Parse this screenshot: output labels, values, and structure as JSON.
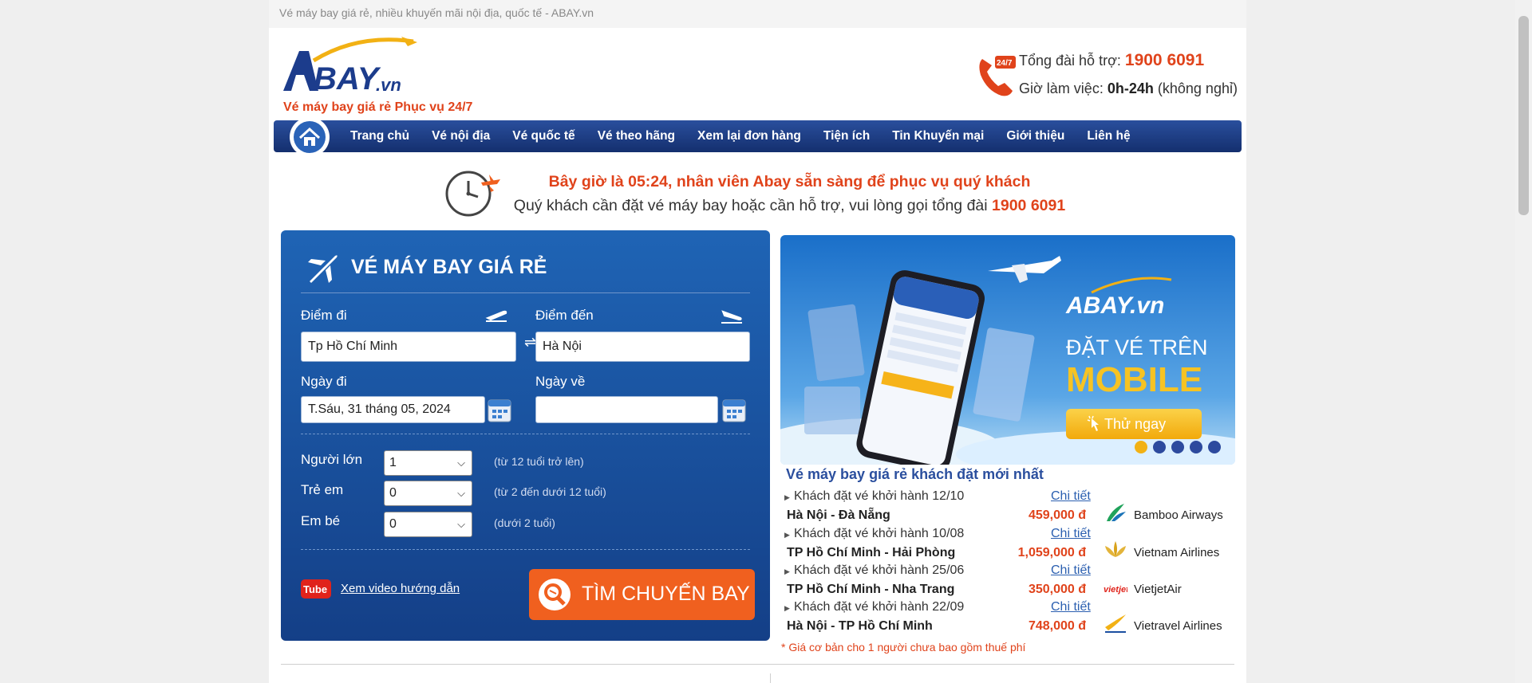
{
  "topbar": {
    "title": "Vé máy bay giá rẻ, nhiều khuyến mãi nội địa, quốc tế - ABAY.vn"
  },
  "header": {
    "logo_text": "ABAY.vn",
    "slogan": "Vé máy bay giá rẻ Phục vụ 24/7",
    "hotline_badge": "24/7",
    "hotline_label": "Tổng đài hỗ trợ:",
    "hotline_number": "1900 6091",
    "hours_label": "Giờ làm việc:",
    "hours_value": "0h-24h",
    "hours_note": "(không nghỉ)"
  },
  "nav": {
    "items": [
      "Trang chủ",
      "Vé nội địa",
      "Vé quốc tế",
      "Vé theo hãng",
      "Xem lại đơn hàng",
      "Tiện ích",
      "Tin Khuyến mại",
      "Giới thiệu",
      "Liên hệ"
    ]
  },
  "notice": {
    "line1": "Bây giờ là 05:24, nhân viên Abay sẵn sàng để phục vụ quý khách",
    "line2": "Quý khách cần đặt vé máy bay hoặc cần hỗ trợ, vui lòng gọi tổng đài",
    "line2_number": "1900 6091"
  },
  "search": {
    "title": "VÉ MÁY BAY GIÁ RẺ",
    "from_label": "Điểm đi",
    "from_value": "Tp Hồ Chí Minh",
    "to_label": "Điểm đến",
    "to_value": "Hà Nội",
    "swap_glyph": "⇌",
    "depart_label": "Ngày đi",
    "depart_value": "T.Sáu, 31 tháng 05, 2024",
    "return_label": "Ngày về",
    "return_value": "",
    "adults_label": "Người lớn",
    "adults_value": "1",
    "adults_note": "(từ 12 tuổi trở lên)",
    "children_label": "Trẻ em",
    "children_value": "0",
    "children_note": "(từ 2 đến dưới 12 tuổi)",
    "infants_label": "Em bé",
    "infants_value": "0",
    "infants_note": "(dưới 2 tuổi)",
    "video_badge": "Tube",
    "video_link": "Xem video hướng dẫn",
    "submit_label": "TÌM CHUYẾN BAY"
  },
  "banner": {
    "brand": "ABAY.vn",
    "line1": "ĐẶT VÉ TRÊN",
    "line2": "MOBILE",
    "cta": "Thử ngay",
    "slides": 5,
    "active_slide": 1
  },
  "recent": {
    "title": "Vé máy bay giá rẻ khách đặt mới nhất",
    "detail_label": "Chi tiết",
    "rows": [
      {
        "when": "Khách đặt vé khởi hành 12/10",
        "route": "Hà Nội - Đà Nẵng",
        "price": "459,000 đ",
        "airline": "Bamboo Airways",
        "logo": "bamboo-logo-icon"
      },
      {
        "when": "Khách đặt vé khởi hành 10/08",
        "route": "TP Hồ Chí Minh - Hải Phòng",
        "price": "1,059,000 đ",
        "airline": "Vietnam Airlines",
        "logo": "lotus-logo-icon"
      },
      {
        "when": "Khách đặt vé khởi hành 25/06",
        "route": "TP Hồ Chí Minh - Nha Trang",
        "price": "350,000 đ",
        "airline": "VietjetAir",
        "logo": "vietjet-logo-icon",
        "logo_text": "vietjet"
      },
      {
        "when": "Khách đặt vé khởi hành 22/09",
        "route": "Hà Nội - TP Hồ Chí Minh",
        "price": "748,000 đ",
        "airline": "Vietravel Airlines",
        "logo": "vietravel-logo-icon"
      }
    ],
    "footnote": "* Giá cơ bản cho 1 người chưa bao gồm thuế phí"
  },
  "colors": {
    "brand_orange": "#e0431b",
    "nav_blue": "#1b3a80",
    "search_blue": "#1a52a0",
    "button_orange": "#f0601f",
    "slider_active": "#f2b114"
  }
}
